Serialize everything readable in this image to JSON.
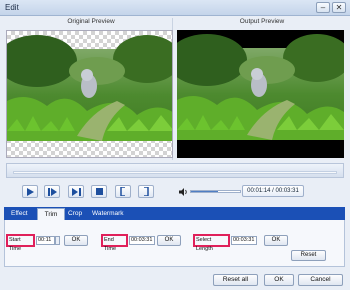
{
  "window": {
    "title": "Edit",
    "minimize_glyph": "–",
    "close_glyph": "✕"
  },
  "previews": {
    "original_label": "Original Preview",
    "output_label": "Output Preview"
  },
  "player": {
    "time_display": "00:01:14 / 00:03:31",
    "volume_level": 0.55,
    "controls": [
      "play-icon",
      "play-step-icon",
      "step-forward-icon",
      "stop-icon",
      "mark-in-icon",
      "mark-out-icon",
      "speaker-icon"
    ]
  },
  "tabs": [
    {
      "label": "Effect"
    },
    {
      "label": "Trim"
    },
    {
      "label": "Crop"
    },
    {
      "label": "Watermark"
    }
  ],
  "active_tab": "Trim",
  "trim": {
    "start_label": "Start Time",
    "start_value": "00:11",
    "end_label": "End Time",
    "end_value": "00:03:31",
    "length_label": "Select Length",
    "length_value": "00:03:31",
    "ok_label": "OK",
    "reset_label": "Reset"
  },
  "footer": {
    "reset_all": "Reset all",
    "ok": "OK",
    "cancel": "Cancel"
  },
  "colors": {
    "tab_bar": "#1b50b6",
    "highlight": "#e0205a"
  }
}
